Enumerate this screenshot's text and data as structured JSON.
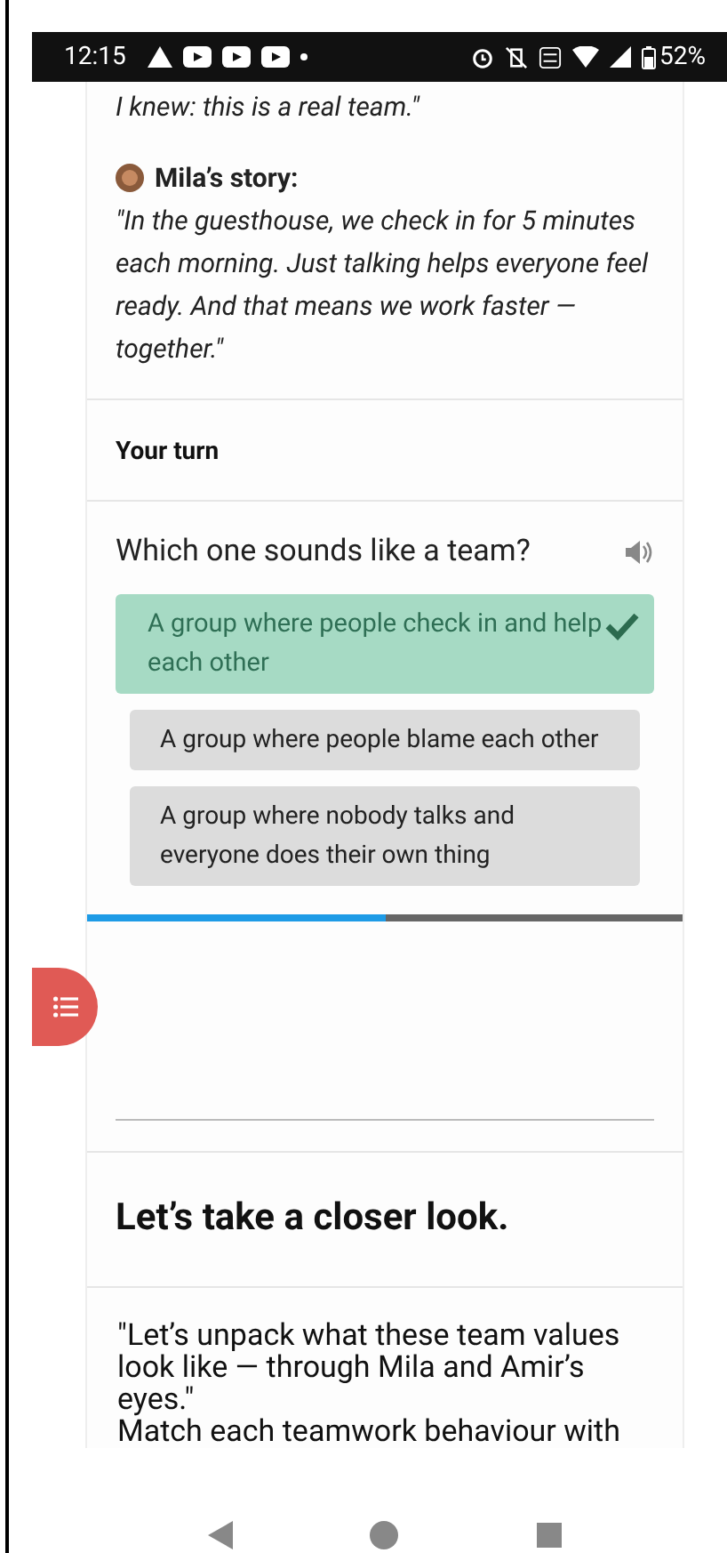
{
  "status_bar": {
    "time": "12:15",
    "battery": "52%"
  },
  "story_tail": "I knew: this is a real team.\"",
  "story": {
    "title": "Mila’s story:",
    "quote": "\"In the guesthouse, we check in for 5 minutes each morning. Just talking helps everyone feel ready. And that means we work faster — together.\""
  },
  "section_heading": "Your turn",
  "quiz": {
    "question": "Which one sounds like a team?",
    "options": [
      {
        "label": "A group where people check in and help each other",
        "selected": true
      },
      {
        "label": "A group where people blame each other",
        "selected": false
      },
      {
        "label": "A group where nobody talks and everyone does their own thing",
        "selected": false
      }
    ],
    "progress": {
      "level": 0.5
    }
  },
  "closer_look": {
    "heading": "Let’s take a closer look.",
    "intro": "\"Let’s unpack what these team values look like — through Mila and Amir’s eyes.\"",
    "instruction": "Match each teamwork behaviour with"
  }
}
